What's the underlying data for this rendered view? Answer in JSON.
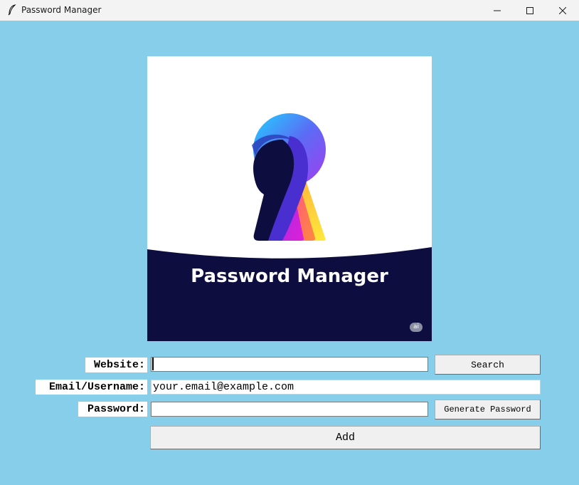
{
  "window": {
    "title": "Password Manager",
    "icon": "feather-icon",
    "controls": [
      "minimize-icon",
      "maximize-icon",
      "close-icon"
    ]
  },
  "logo": {
    "title": "Password Manager",
    "badge": "ai",
    "colors": {
      "navy": "#0d0e3f",
      "cyan": "#1fd2ff",
      "purple": "#8a3cf0",
      "magenta": "#e01fd6",
      "orange": "#ff7a3c",
      "yellow": "#ffe23b"
    }
  },
  "form": {
    "website_label": "Website:",
    "website_value": "",
    "email_label": "Email/Username:",
    "email_value": "your.email@example.com",
    "password_label": "Password:",
    "password_value": "",
    "search_label": "Search",
    "generate_label": "Generate Password",
    "add_label": "Add"
  },
  "colors": {
    "background": "#87ceeb",
    "titlebar": "#f3f3f3",
    "button": "#f0f0f0"
  }
}
